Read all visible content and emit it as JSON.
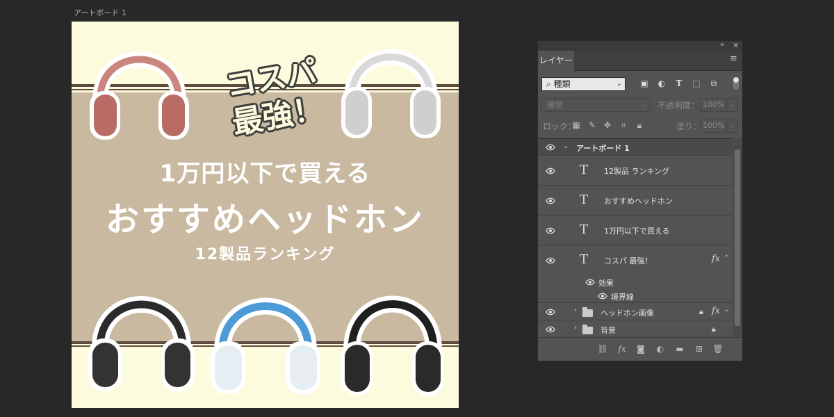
{
  "artboard": {
    "label": "アートボード 1",
    "promo_line1": "コスパ",
    "promo_line2": "最強！",
    "headline_small": "1万円以下で買える",
    "headline_big": "おすすめヘッドホン",
    "headline_sub": "12製品ランキング",
    "colors": {
      "cream": "#fdfbdd",
      "beige": "#c8b9a0",
      "band": "#5e4c40"
    }
  },
  "layers_panel": {
    "tab_label": "レイヤー",
    "filter_label": "種類",
    "blend_mode": "通常",
    "opacity_label": "不透明度：",
    "opacity_value": "100%",
    "lock_label": "ロック：",
    "fill_label": "塗り：",
    "fill_value": "100%",
    "layers": [
      {
        "label": "アートボード 1",
        "type": "artboard"
      },
      {
        "label": "12製品 ランキング",
        "type": "text"
      },
      {
        "label": "おすすめヘッドホン",
        "type": "text"
      },
      {
        "label": "1万円以下で買える",
        "type": "text"
      },
      {
        "label": "コスパ  最強！",
        "type": "text",
        "has_fx": true
      },
      {
        "label": "効果",
        "type": "effect-group"
      },
      {
        "label": "境界線",
        "type": "effect"
      },
      {
        "label": "ヘッドホン画像",
        "type": "group",
        "locked": true,
        "has_fx": true
      },
      {
        "label": "背景",
        "type": "group",
        "locked": true
      }
    ],
    "fx_label": "fx"
  }
}
